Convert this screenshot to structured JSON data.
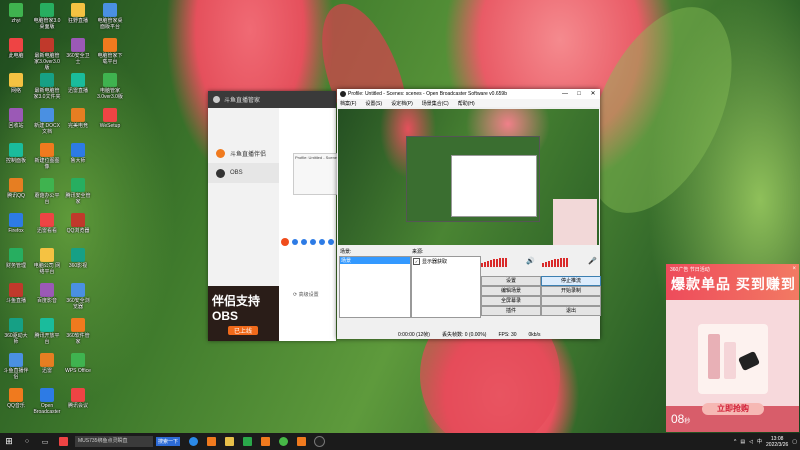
{
  "desktop": {
    "icons_col1": [
      "zhyi",
      "此电脑",
      "网络",
      "回收站",
      "控制面板",
      "腾讯QQ",
      "Firefox",
      "财务管理",
      "斗鱼直播",
      "360驱动大师",
      "斗鱼直播伴侣",
      "QQ音乐"
    ],
    "icons_col2": [
      "电脑管家3.0桌面版",
      "最新电脑管家3.0ver3.0版",
      "最新电脑管家3.0文件夹",
      "新建 DOCX 文档",
      "新建位图图像",
      "蘑菇办公平台",
      "迅雷看看",
      "电脑公司 网络平台",
      "百度影音",
      "腾讯开放平台",
      "迅雷",
      "Open Broadcaster"
    ],
    "icons_col3": [
      "狂野直播",
      "360安全卫士",
      "迅雷直播",
      "完美电竞",
      "鲁大师",
      "腾讯安全管家",
      "QQ浏览器",
      "360影视",
      "360安全浏览器",
      "360软件管家",
      "WPS Office",
      "腾讯会议"
    ],
    "icons_col4": [
      "电脑管家桌面版平台",
      "电脑管家下载平台",
      "电脑管家3.0ver3.0版",
      "WeSetup"
    ]
  },
  "douyu_window": {
    "title": "斗鱼直播管家",
    "side_items": [
      {
        "label": "斗鱼直播伴侣",
        "color": "#f07a1e"
      },
      {
        "label": "OBS",
        "color": "#333333"
      }
    ],
    "promo_title": "伴侣支持OBS",
    "promo_button": "已上线",
    "thumb_title": "Profile: Untitled - Scenes",
    "advanced_link": "高级设置"
  },
  "obs_window": {
    "title": "Profile: Untitled - Scenes: scenes - Open Broadcaster Software v0.659b",
    "window_controls": [
      "—",
      "□",
      "✕"
    ],
    "menu": [
      "档案(F)",
      "设置(S)",
      "设定档(P)",
      "场景集合(C)",
      "帮助(H)"
    ],
    "scenes_label": "场景:",
    "scenes_items": [
      "场景"
    ],
    "sources_label": "来源:",
    "sources_items": [
      {
        "label": "显示器获取",
        "checked": true
      }
    ],
    "buttons_left": [
      "设置",
      "编辑场景",
      "全屏幕录",
      "插件"
    ],
    "buttons_right": [
      "停止推流",
      "开始录制",
      "",
      "退出"
    ],
    "status": {
      "time": "0:00:00 (12帧)",
      "dropped": "丢失帧数: 0 (0.00%)",
      "fps": "FPS: 30",
      "kbps": "0kb/s"
    },
    "meter_levels": [
      0.45,
      0.55,
      0.65,
      0.75,
      0.85,
      0.9,
      0.95,
      1.0,
      1.0
    ]
  },
  "ad_popup": {
    "small_text": "360广告 节日活动",
    "headline": "爆款单品 买到赚到",
    "timer": "08",
    "timer_unit": "秒",
    "button": "立即抢购",
    "close": "×"
  },
  "taskbar": {
    "search_text": "MUS735绑鱼点灵瞬直",
    "search_button": "搜索一下",
    "time": "13:08",
    "date": "2022/3/26",
    "tray_lang": "中"
  }
}
